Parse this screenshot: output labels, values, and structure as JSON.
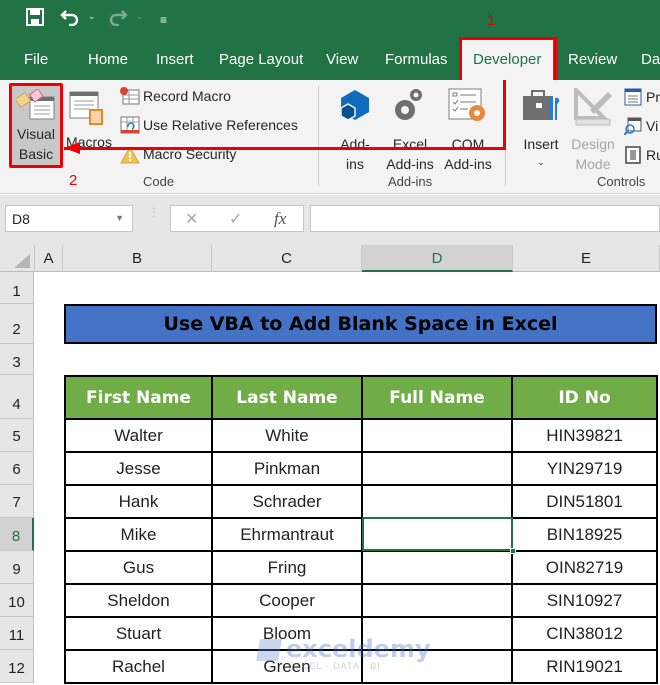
{
  "quick_access": {
    "save_icon": "save-icon",
    "undo_icon": "undo-icon",
    "redo_icon": "redo-icon",
    "customize_icon": "customize-qat-icon"
  },
  "tabs": [
    {
      "label": "File"
    },
    {
      "label": "Home"
    },
    {
      "label": "Insert"
    },
    {
      "label": "Page Layout"
    },
    {
      "label": "View"
    },
    {
      "label": "Formulas"
    },
    {
      "label": "Developer",
      "active": true
    },
    {
      "label": "Review"
    },
    {
      "label": "Da"
    }
  ],
  "annotations": {
    "step1": "1",
    "step2": "2",
    "color": "#ee0000"
  },
  "ribbon": {
    "code_group": {
      "label": "Code",
      "visual_basic": [
        "Visual",
        "Basic"
      ],
      "macros": "Macros",
      "record_macro": "Record Macro",
      "use_relative_references": "Use Relative References",
      "macro_security": "Macro Security"
    },
    "addins_group": {
      "label": "Add-ins",
      "addins": [
        "Add-",
        "ins"
      ],
      "excel_addins": [
        "Excel",
        "Add-ins"
      ],
      "com_addins": [
        "COM",
        "Add-ins"
      ]
    },
    "controls_group": {
      "label": "Controls",
      "insert": "Insert",
      "design_mode": [
        "Design",
        "Mode"
      ],
      "properties": "Pr",
      "view_code": "Vi",
      "run_dialog": "Ru"
    }
  },
  "formula_bar": {
    "name_box": "D8",
    "cancel_icon": "✕",
    "enter_icon": "✓",
    "fx_label": "fx",
    "value": ""
  },
  "columns": [
    "A",
    "B",
    "C",
    "D",
    "E"
  ],
  "selected_column": "D",
  "rows": [
    "1",
    "2",
    "3",
    "4",
    "5",
    "6",
    "7",
    "8",
    "9",
    "10",
    "11",
    "12"
  ],
  "selected_row": "8",
  "sheet": {
    "title": "Use VBA to Add Blank Space in Excel",
    "title_bg": "#4472c4",
    "header_bg": "#70ad47",
    "headers": [
      "First Name",
      "Last Name",
      "Full Name",
      "ID No"
    ],
    "records": [
      [
        "Walter",
        "White",
        "",
        "HIN39821"
      ],
      [
        "Jesse",
        "Pinkman",
        "",
        "YIN29719"
      ],
      [
        "Hank",
        "Schrader",
        "",
        "DIN51801"
      ],
      [
        "Mike",
        "Ehrmantraut",
        "",
        "BIN18925"
      ],
      [
        "Gus",
        "Fring",
        "",
        "OIN82719"
      ],
      [
        "Sheldon",
        "Cooper",
        "",
        "SIN10927"
      ],
      [
        "Stuart",
        "Bloom",
        "",
        "CIN38012"
      ],
      [
        "Rachel",
        "Green",
        "",
        "RIN19021"
      ]
    ]
  },
  "watermark": {
    "brand": "exceldemy",
    "tagline": "EXCEL · DATA · BI"
  }
}
